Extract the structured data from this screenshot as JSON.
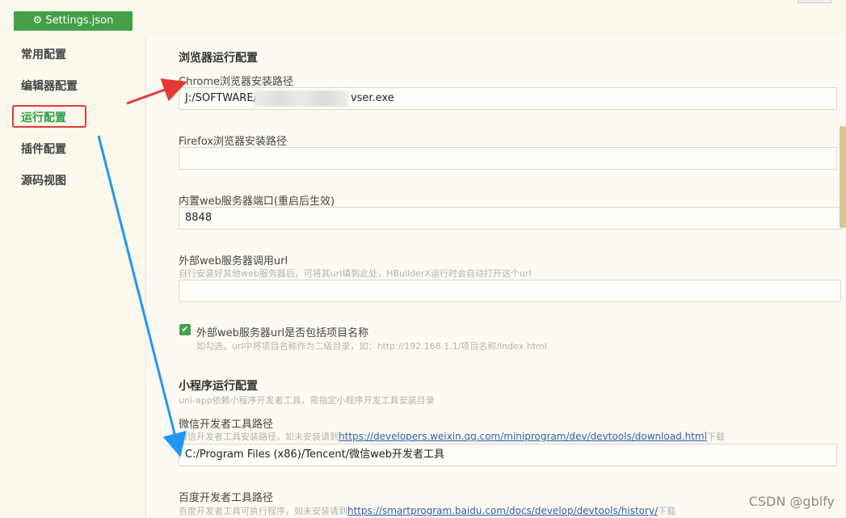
{
  "header": {
    "settings_button": "Settings.json"
  },
  "sidebar": {
    "items": [
      {
        "label": "常用配置"
      },
      {
        "label": "编辑器配置"
      },
      {
        "label": "运行配置",
        "active": true
      },
      {
        "label": "插件配置"
      },
      {
        "label": "源码视图"
      }
    ]
  },
  "browser_section": {
    "title": "浏览器运行配置",
    "chrome_label": "Chrome浏览器安装路径",
    "chrome_value_start": "J:/SOFTWARE/",
    "chrome_value_end": "vser.exe",
    "firefox_label": "Firefox浏览器安装路径",
    "firefox_value": "",
    "port_label": "内置web服务器端口(重启后生效)",
    "port_value": "8848",
    "ext_server_label": "外部web服务器调用url",
    "ext_server_hint": "自行安装好其他web服务器后，可将其url填到此处，HBuilderX运行时会自动打开这个url",
    "ext_server_value": "",
    "checkbox_label": "外部web服务器url是否包括项目名称",
    "checkbox_checked": true,
    "checkbox_hint": "如勾选，url中将项目名称作为二级目录，如：http://192.168.1.1/项目名称/index.html"
  },
  "miniprogram_section": {
    "title": "小程序运行配置",
    "hint": "uni-app依赖小程序开发者工具，需指定小程序开发工具安装目录",
    "wechat_label": "微信开发者工具路径",
    "wechat_hint_prefix": "微信开发者工具安装路径，如未安装请到",
    "wechat_link": "https://developers.weixin.qq.com/miniprogram/dev/devtools/download.html",
    "wechat_hint_suffix": "下载",
    "wechat_value": "C:/Program Files (x86)/Tencent/微信web开发者工具",
    "baidu_label": "百度开发者工具路径",
    "baidu_hint_prefix": "百度开发者工具可执行程序，如未安装请到",
    "baidu_link": "https://smartprogram.baidu.com/docs/develop/devtools/history/",
    "baidu_hint_suffix": "下载"
  },
  "watermark": "CSDN @gblfy",
  "colors": {
    "accent": "#43a047",
    "active_text": "#2e9b47",
    "annotation_red": "#e53935",
    "annotation_blue": "#2196f3",
    "link": "#2c5fb0"
  }
}
